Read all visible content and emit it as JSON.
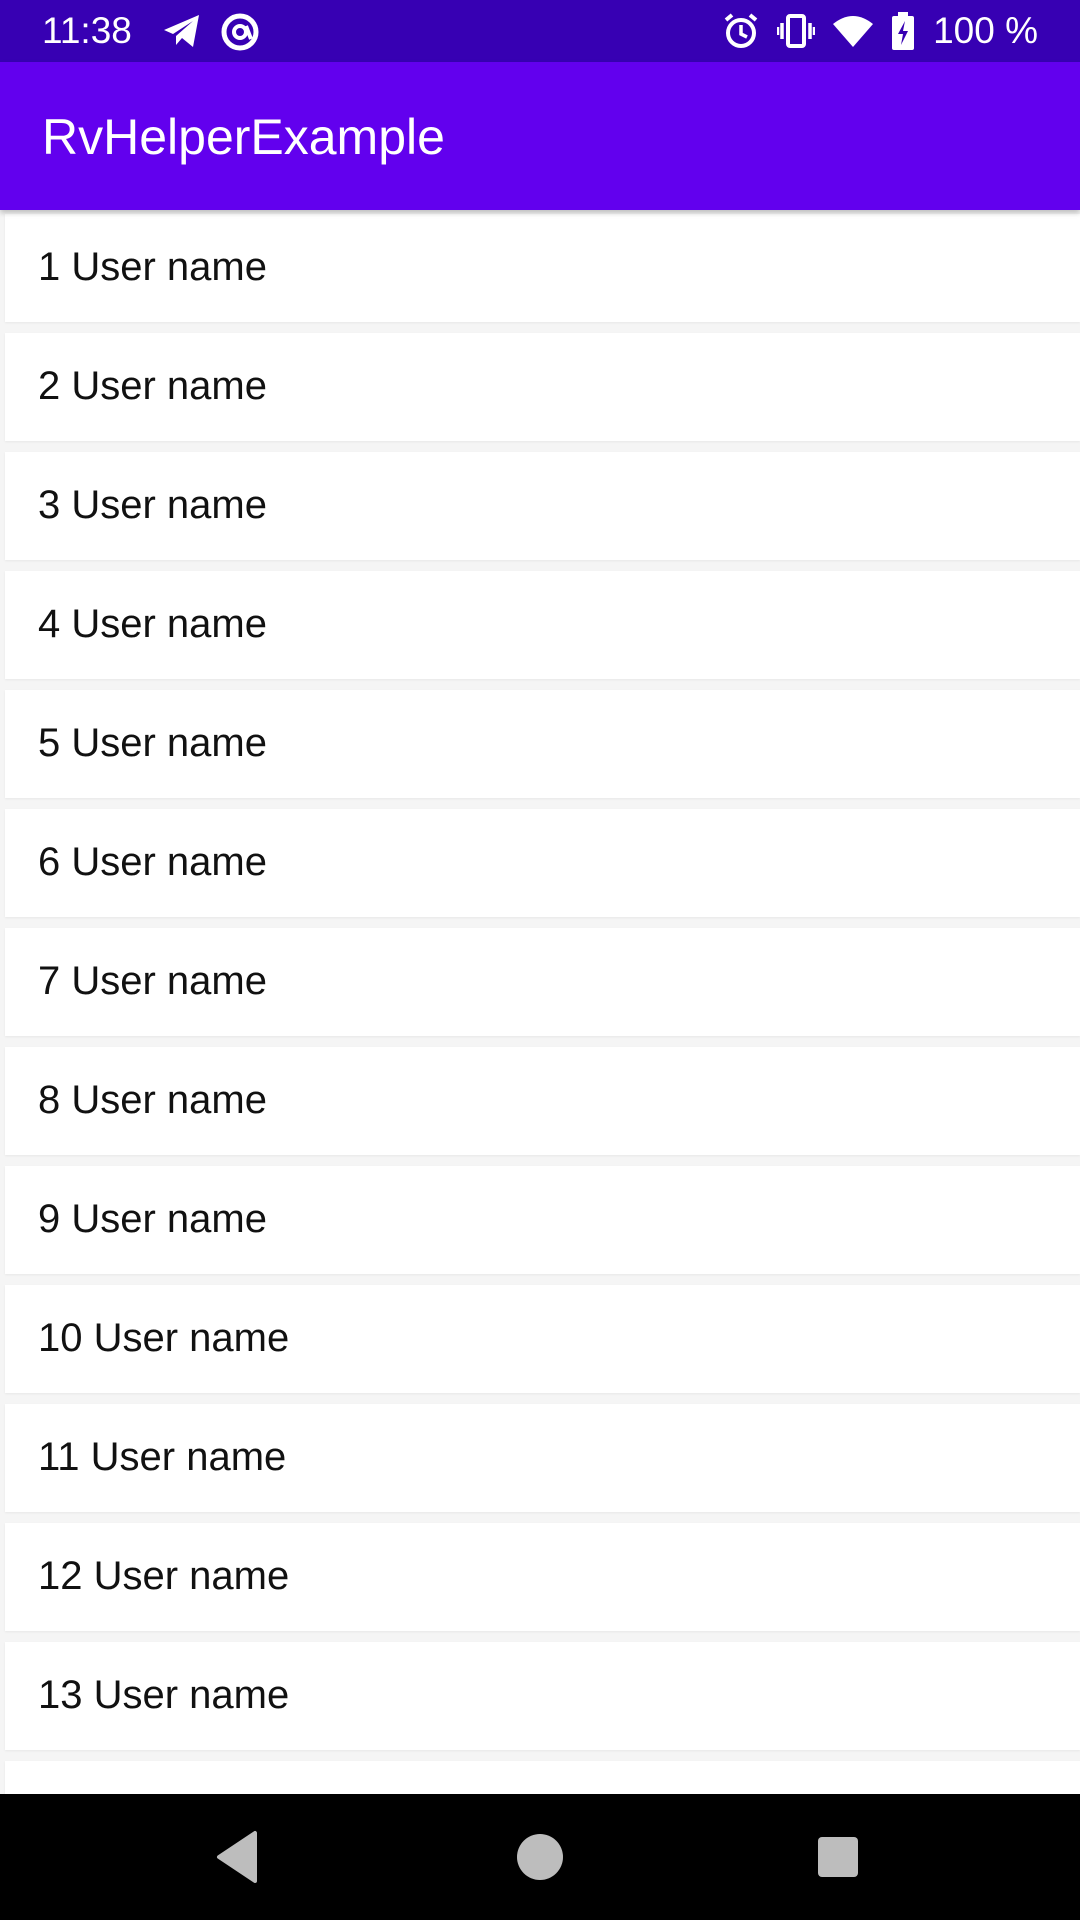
{
  "status_bar": {
    "time": "11:38",
    "battery_text": "100 %",
    "icons_left": [
      "telegram-icon",
      "at-sign-icon"
    ],
    "icons_right": [
      "alarm-icon",
      "vibrate-icon",
      "wifi-icon",
      "battery-charging-icon"
    ]
  },
  "app_bar": {
    "title": "RvHelperExample",
    "color": "#6200ee"
  },
  "list": {
    "items": [
      {
        "label": "1 User name"
      },
      {
        "label": "2 User name"
      },
      {
        "label": "3 User name"
      },
      {
        "label": "4 User name"
      },
      {
        "label": "5 User name"
      },
      {
        "label": "6 User name"
      },
      {
        "label": "7 User name"
      },
      {
        "label": "8 User name"
      },
      {
        "label": "9 User name"
      },
      {
        "label": "10 User name"
      },
      {
        "label": "11 User name"
      },
      {
        "label": "12 User name"
      },
      {
        "label": "13 User name"
      },
      {
        "label": ""
      }
    ]
  },
  "nav_bar": {
    "buttons": [
      "back-icon",
      "home-icon",
      "recents-icon"
    ]
  }
}
